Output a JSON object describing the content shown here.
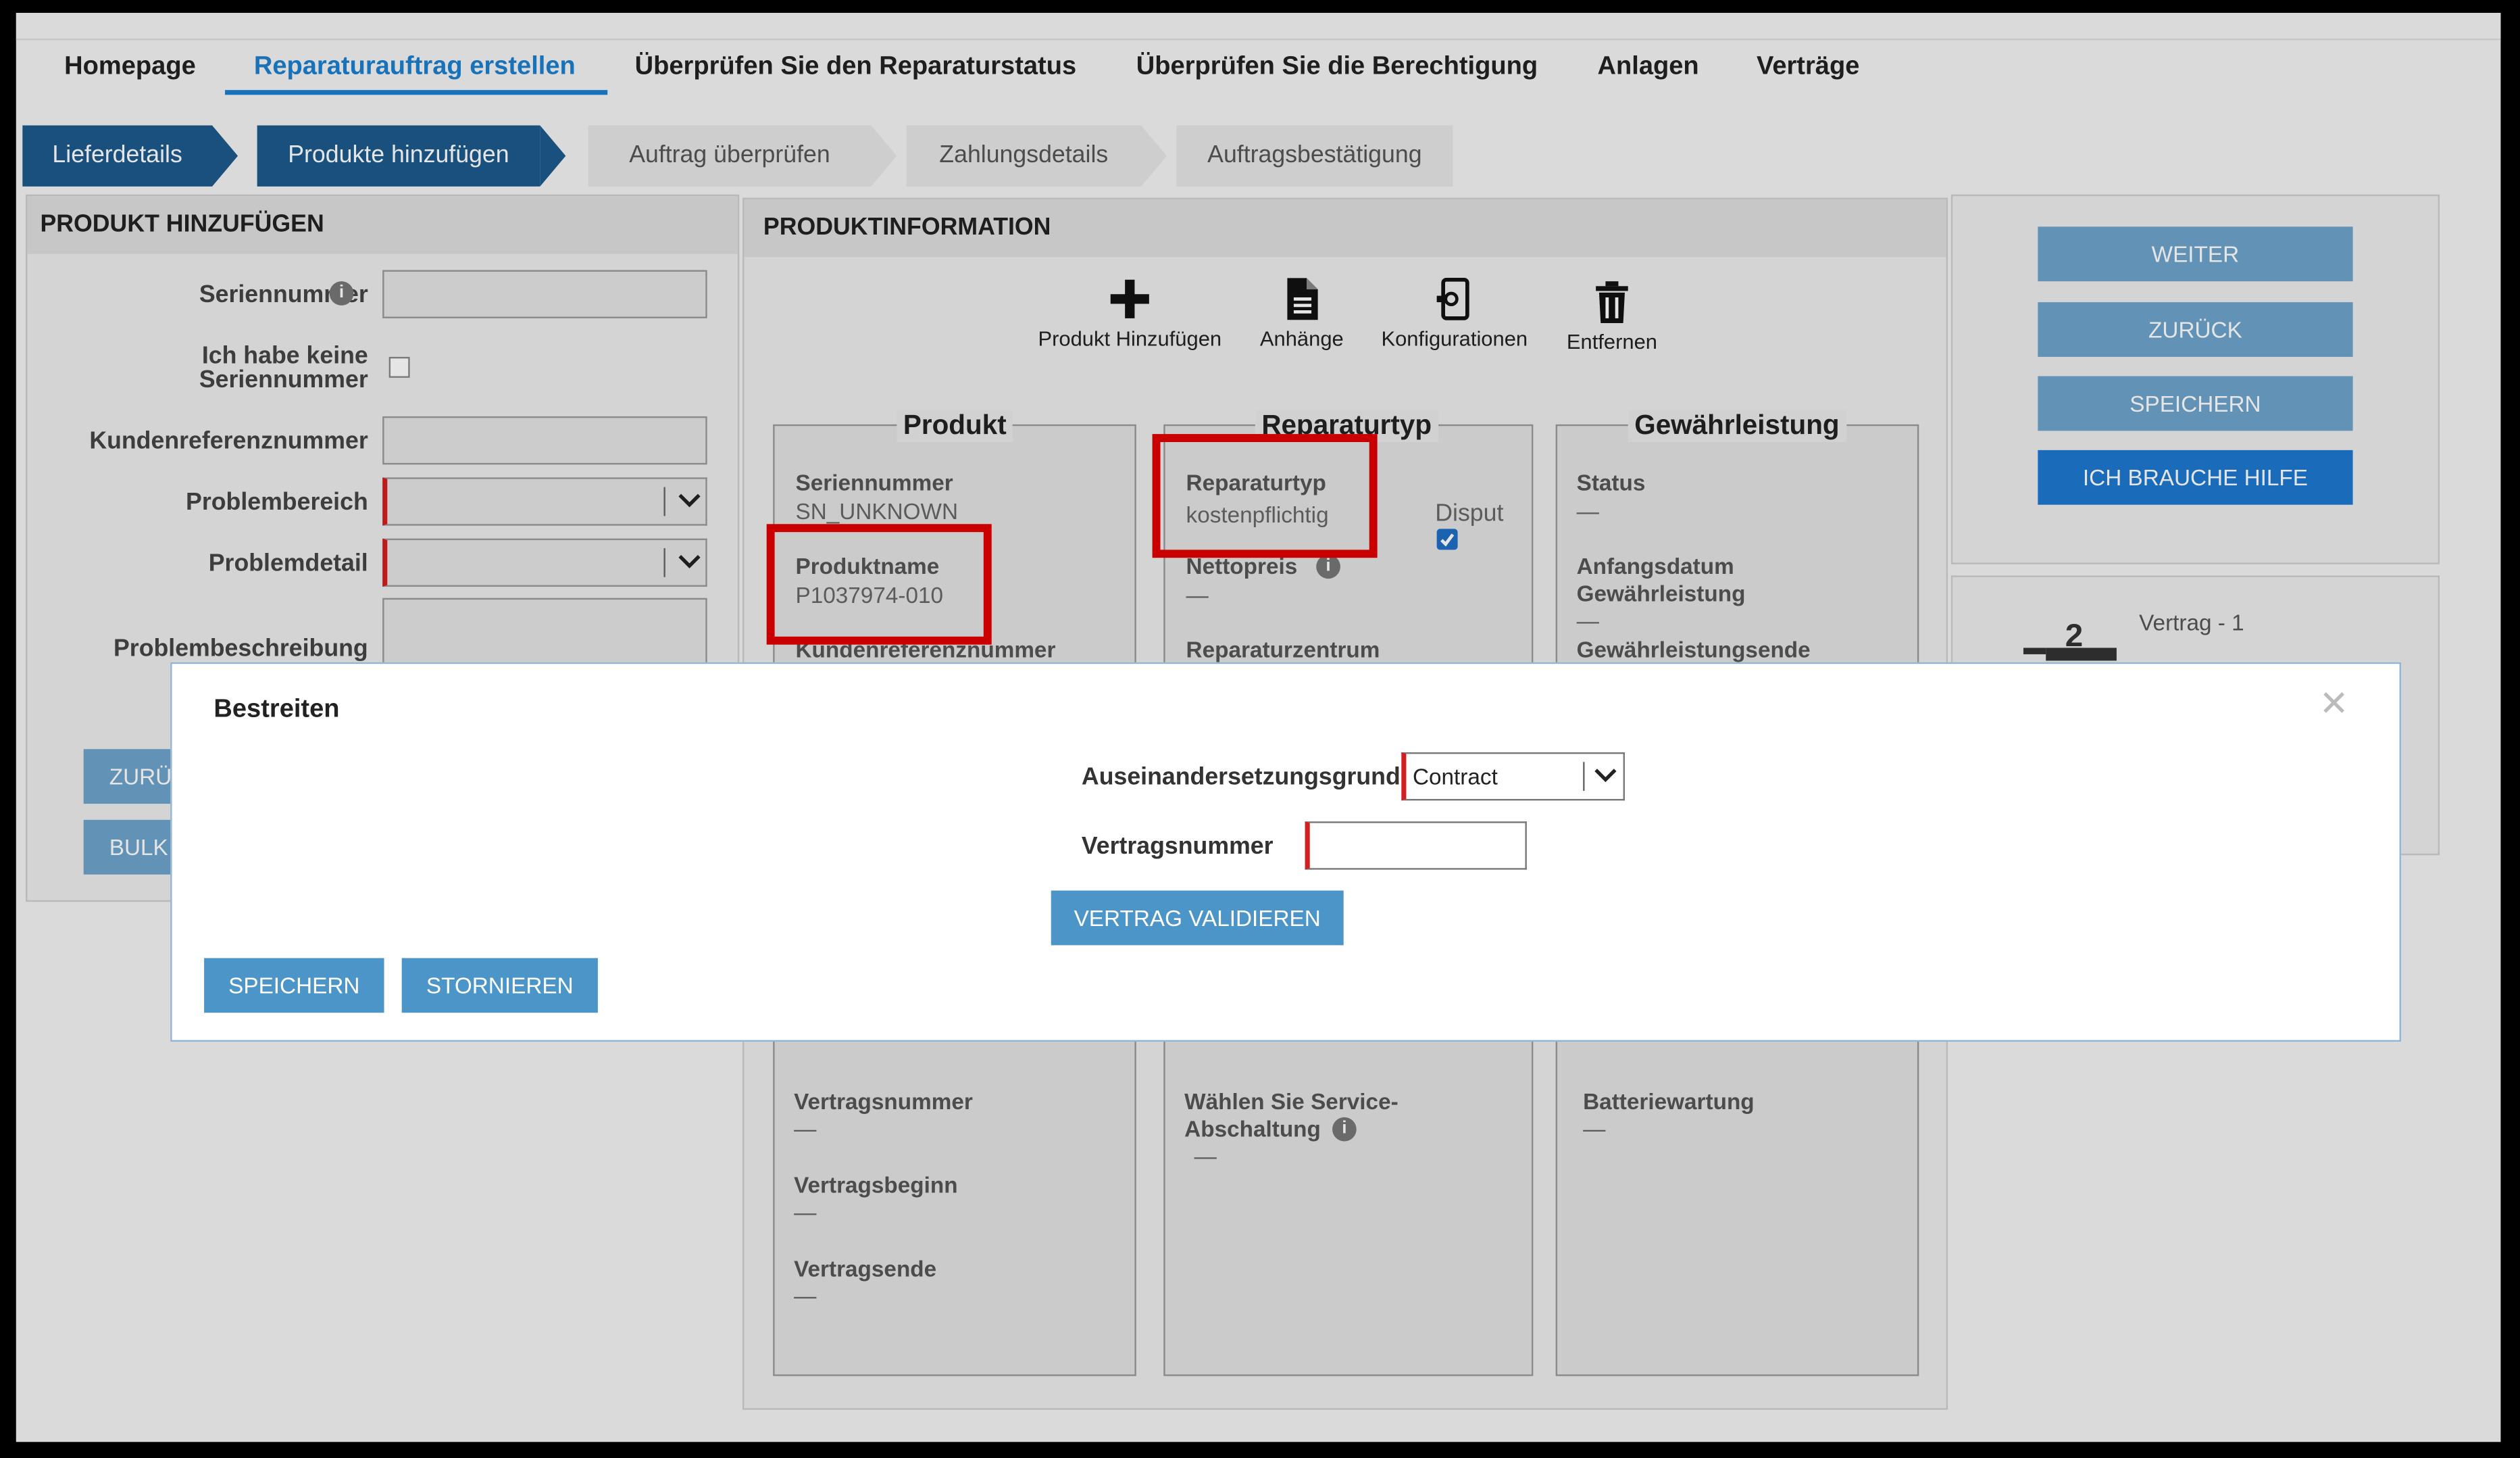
{
  "nav": {
    "items": [
      "Homepage",
      "Reparaturauftrag erstellen",
      "Überprüfen Sie den Reparaturstatus",
      "Überprüfen Sie die Berechtigung",
      "Anlagen",
      "Verträge"
    ],
    "active": "Reparaturauftrag erstellen"
  },
  "steps": [
    "Lieferdetails",
    "Produkte hinzufügen",
    "Auftrag überprüfen",
    "Zahlungsdetails",
    "Auftragsbestätigung"
  ],
  "left_panel": {
    "title": "PRODUKT HINZUFÜGEN",
    "serial_label": "Seriennummer",
    "no_serial_label_1": "Ich habe keine",
    "no_serial_label_2": "Seriennummer",
    "customer_ref_label": "Kundenreferenznummer",
    "problem_area_label": "Problembereich",
    "problem_detail_label": "Problemdetail",
    "problem_desc_label": "Problembeschreibung",
    "back_button_partial": "ZURÜ",
    "bulk_button_partial": "BULK"
  },
  "product_info": {
    "title": "PRODUKTINFORMATION",
    "toolbar": {
      "add_product": "Produkt Hinzufügen",
      "attachments": "Anhänge",
      "configurations": "Konfigurationen",
      "remove": "Entfernen"
    },
    "product_card": {
      "title": "Produkt",
      "serial_label": "Seriennummer",
      "serial_value": "SN_UNKNOWN",
      "name_label": "Produktname",
      "name_value": "P1037974-010",
      "custref_label": "Kundenreferenznummer"
    },
    "repair_card": {
      "title": "Reparaturtyp",
      "type_label": "Reparaturtyp",
      "type_value": "kostenpflichtig",
      "dispute_label": "Disput",
      "net_price_label": "Nettopreis",
      "net_price_value": "—",
      "repair_center_label": "Reparaturzentrum"
    },
    "warranty_card": {
      "title": "Gewährleistung",
      "status_label": "Status",
      "status_value": "—",
      "start_label_1": "Anfangsdatum",
      "start_label_2": "Gewährleistung",
      "start_value": "—",
      "end_label": "Gewährleistungsende"
    },
    "contract_section": {
      "contract_number_label": "Vertragsnummer",
      "contract_number_value": "—",
      "contract_start_label": "Vertragsbeginn",
      "contract_start_value": "—",
      "contract_end_label": "Vertragsende",
      "contract_end_value": "—",
      "service_shutdown_label_1": "Wählen Sie Service-",
      "service_shutdown_label_2": "Abschaltung",
      "service_shutdown_value": "—",
      "battery_label": "Batteriewartung",
      "battery_value": "—"
    }
  },
  "right_panel": {
    "next": "WEITER",
    "back": "ZURÜCK",
    "save": "SPEICHERN",
    "help": "ICH BRAUCHE HILFE",
    "cart_count": "2",
    "contract_label": "Vertrag - 1"
  },
  "modal": {
    "title": "Bestreiten",
    "reason_label": "Auseinandersetzungsgrund",
    "reason_value": "Contract",
    "contract_label": "Vertragsnummer",
    "contract_value": "",
    "validate_button": "VERTRAG VALIDIEREN",
    "save_button": "SPEICHERN",
    "cancel_button": "STORNIEREN",
    "close_glyph": "✕"
  },
  "colors": {
    "accent": "#1a7fd0",
    "step_done": "#1d5a8c",
    "button": "#4c95c8",
    "highlight": "#e10000",
    "required": "#d21f1f"
  }
}
